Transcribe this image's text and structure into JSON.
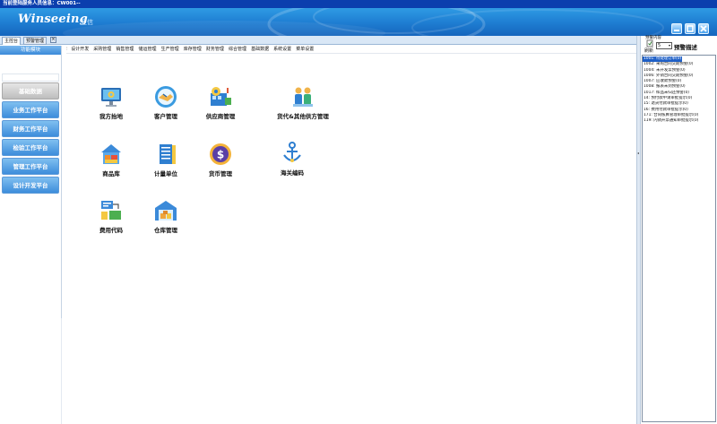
{
  "window": {
    "title": "当前登陆服务人员信息：CW001--"
  },
  "banner": {
    "logo": "Winseeing",
    "logo_cn": "汇信",
    "colors": {
      "top": "#2f9be4",
      "bottom": "#1565bd"
    }
  },
  "tabs": [
    {
      "label": "主控台"
    },
    {
      "label": "预警管理"
    }
  ],
  "tab_close_glyph": "×",
  "sidebar": {
    "header": "功能模块",
    "items": [
      {
        "label": "基础数据",
        "style": "gray"
      },
      {
        "label": "业务工作平台"
      },
      {
        "label": "财务工作平台"
      },
      {
        "label": "检验工作平台"
      },
      {
        "label": "管理工作平台"
      },
      {
        "label": "设计开发平台"
      }
    ]
  },
  "menubar": {
    "items": [
      "设计开发",
      "采购管理",
      "销售管理",
      "储运管理",
      "生产管理",
      "库存管理",
      "财务管理",
      "综合管理",
      "基础数据",
      "系统设置",
      "菜单设置"
    ]
  },
  "tiles": [
    {
      "label": "我方抬地",
      "icon": "computer-settings-icon"
    },
    {
      "label": "客户管理",
      "icon": "customer-handshake-icon"
    },
    {
      "label": "供应商管理",
      "icon": "supplier-factory-icon"
    },
    {
      "label": "货代&其他供方管理",
      "icon": "forwarder-people-icon"
    },
    {
      "label": "商品库",
      "icon": "product-house-icon"
    },
    {
      "label": "计量单位",
      "icon": "measure-books-icon"
    },
    {
      "label": "货币管理",
      "icon": "currency-coin-icon"
    },
    {
      "label": "海关编码",
      "icon": "customs-anchor-icon"
    },
    {
      "label": "费用代码",
      "icon": "expense-code-icon"
    },
    {
      "label": "仓库管理",
      "icon": "warehouse-icon"
    }
  ],
  "right_panel": {
    "caption": "预警内容",
    "refresh": "刷新",
    "select_value": "5",
    "title": "预警描述",
    "items": [
      "1001: 待处理订单(0)",
      "1002: 采购合同交期预警(0)",
      "1004: 未开发票预警(0)",
      "1006: 外销合同交期预警(0)",
      "1007: 应收款预警(0)",
      "1008: 报表未到预警(0)",
      "1017: 样品未归还预警(0)",
      "14: 预付款申请审批提示(0)",
      "15: 退货付款审批提示(0)",
      "16: 费用付款审批提示(0)",
      "171: 合同核算管理审批提示(0)",
      "119: 内销开票通知审批提示(0)"
    ],
    "selected_index": 0,
    "selected_color": "#1e5fc6"
  }
}
